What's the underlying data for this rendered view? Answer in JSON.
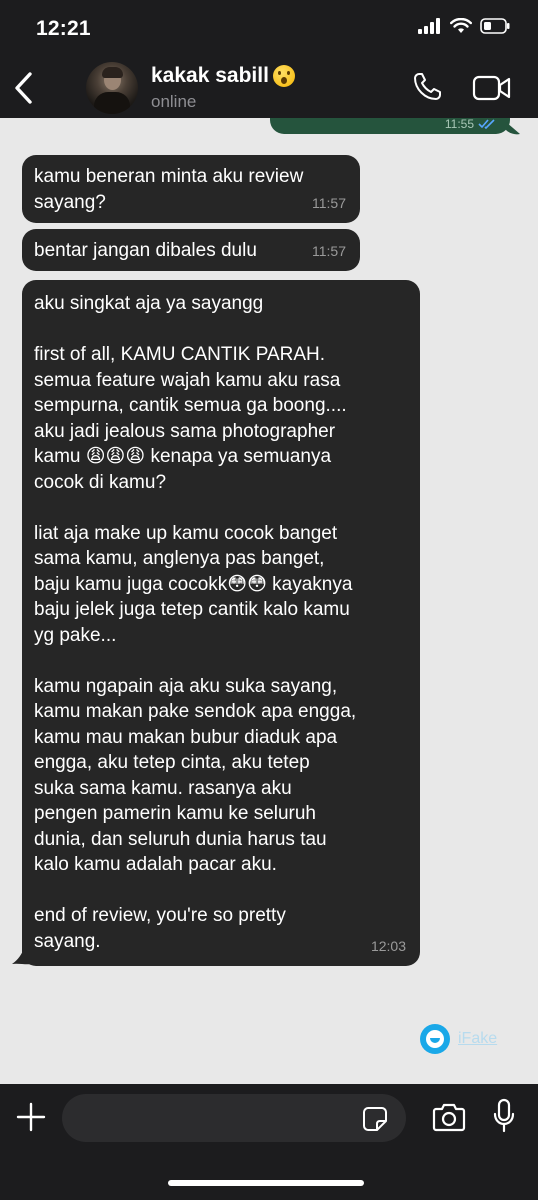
{
  "status_bar": {
    "time": "12:21"
  },
  "header": {
    "contact_name": "kakak sabill",
    "contact_status": "online",
    "icons": [
      "back-icon",
      "call-icon",
      "video-call-icon"
    ],
    "colors": {
      "background": "#1c1c1e",
      "status_text": "#8e8e93"
    }
  },
  "messages": {
    "outgoing_partial": {
      "time": "11:55"
    },
    "incoming": [
      {
        "text": "kamu beneran minta aku review\nsayang?",
        "time": "11:57"
      },
      {
        "text": "bentar jangan dibales dulu",
        "time": "11:57"
      },
      {
        "text": "aku singkat aja ya sayangg\n\nfirst of all, KAMU CANTIK PARAH.\nsemua feature wajah kamu aku rasa\nsempurna, cantik semua ga boong....\naku jadi jealous sama photographer\nkamu 😩😩😩 kenapa ya semuanya\ncocok di kamu?\n\nliat aja make up kamu cocok banget\nsama kamu, anglenya pas banget,\nbaju kamu juga cocokk😳😳 kayaknya\nbaju jelek juga tetep cantik kalo kamu\nyg pake...\n\nkamu ngapain aja aku suka sayang,\nkamu makan pake sendok apa engga,\nkamu mau makan bubur diaduk apa\nengga, aku tetep cinta, aku tetep\nsuka sama kamu. rasanya aku\npengen pamerin kamu ke seluruh\ndunia, dan seluruh dunia harus tau\nkalo kamu adalah pacar aku.\n\nend of review, you're so pretty\nsayang.",
        "time": "12:03"
      }
    ],
    "colors": {
      "incoming_bubble": "#262626",
      "outgoing_bubble": "#25543d",
      "chat_background": "#e8e8e8"
    }
  },
  "watermark": {
    "text": "iFake"
  },
  "composer": {
    "placeholder": "",
    "value": "",
    "icons": [
      "plus-icon",
      "sticker-icon",
      "camera-icon",
      "microphone-icon"
    ]
  }
}
